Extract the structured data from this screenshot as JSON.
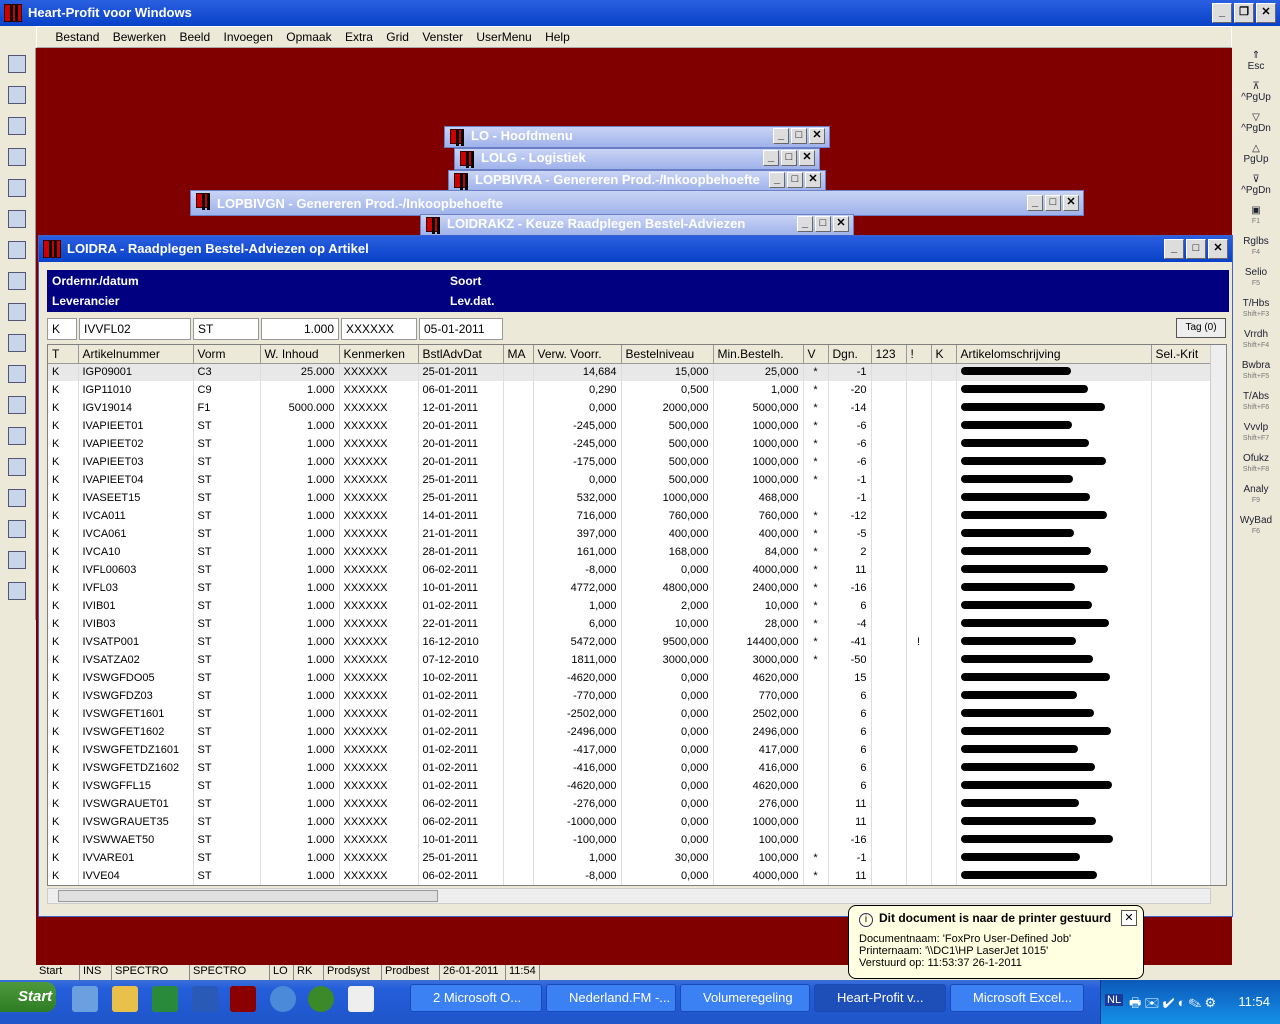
{
  "app": {
    "title": "Heart-Profit voor Windows"
  },
  "menu": [
    "Bestand",
    "Bewerken",
    "Beeld",
    "Invoegen",
    "Opmaak",
    "Extra",
    "Grid",
    "Venster",
    "UserMenu",
    "Help"
  ],
  "right_toolbar": [
    {
      "label": "Esc",
      "sub": ""
    },
    {
      "label": "^PgUp",
      "sub": ""
    },
    {
      "label": "^PgDn",
      "sub": ""
    },
    {
      "label": "PgUp",
      "sub": ""
    },
    {
      "label": "^PgDn",
      "sub": ""
    },
    {
      "label": "",
      "sub": "F1"
    },
    {
      "label": "Rglbs",
      "sub": "F4"
    },
    {
      "label": "Selio",
      "sub": "F5"
    },
    {
      "label": "T/Hbs",
      "sub": "Shift+F3"
    },
    {
      "label": "Vrrdh",
      "sub": "Shift+F4"
    },
    {
      "label": "Bwbra",
      "sub": "Shift+F5"
    },
    {
      "label": "T/Abs",
      "sub": "Shift+F6"
    },
    {
      "label": "Vvvlp",
      "sub": "Shift+F7"
    },
    {
      "label": "Ofukz",
      "sub": "Shift+F8"
    },
    {
      "label": "Analy",
      "sub": "F9"
    },
    {
      "label": "WyBad",
      "sub": "F6"
    }
  ],
  "subwindows": [
    "LO - Hoofdmenu",
    "LOLG - Logistiek",
    "LOPBIVRA - Genereren Prod.-/Inkoopbehoefte",
    "LOPBIVGN - Genereren Prod.-/Inkoopbehoefte",
    "LOIDRAKZ - Keuze Raadplegen Bestel-Adviezen"
  ],
  "main": {
    "title": "LOIDRA - Raadplegen Bestel-Adviezen op Artikel",
    "header": {
      "ordernr": "Ordernr./datum",
      "soort": "Soort",
      "leverancier": "Leverancier",
      "levdat": "Lev.dat."
    },
    "filter": {
      "t": "K",
      "artikel": "IVVFL02",
      "vorm": "ST",
      "inhoud": "1.000",
      "kenmerken": "XXXXXX",
      "datum": "05-01-2011"
    },
    "tag_button": "Tag (0)",
    "columns": [
      "T",
      "Artikelnummer",
      "Vorm",
      "W. Inhoud",
      "Kenmerken",
      "BstlAdvDat",
      "MA",
      "Verw. Voorr.",
      "Bestelniveau",
      "Min.Bestelh.",
      "V",
      "Dgn.",
      "123",
      "!",
      "K",
      "Artikelomschrijving",
      "Sel.-Krit"
    ],
    "rows": [
      [
        "K",
        "IGP09001",
        "C3",
        "25.000",
        "XXXXXX",
        "25-01-2011",
        "",
        "14,684",
        "15,000",
        "25,000",
        "*",
        "-1",
        "",
        "",
        "",
        "Igo... DP300",
        ""
      ],
      [
        "K",
        "IGP11010",
        "C9",
        "1.000",
        "XXXXXX",
        "06-01-2011",
        "",
        "0,290",
        "0,500",
        "1,000",
        "*",
        "-20",
        "",
        "",
        "",
        "Kla... / Fl... Nat...",
        ""
      ],
      [
        "K",
        "IGV19014",
        "F1",
        "5000.000",
        "XXXXXX",
        "12-01-2011",
        "",
        "0,000",
        "2000,000",
        "5000,000",
        "*",
        "-14",
        "",
        "",
        "",
        "Lab... LTGS (Sym... 15/3)",
        ""
      ],
      [
        "K",
        "IVAPIEET01",
        "ST",
        "1.000",
        "XXXXXX",
        "20-01-2011",
        "",
        "-245,000",
        "500,000",
        "1000,000",
        "*",
        "-6",
        "",
        "",
        "",
        "Etiket ...",
        ""
      ],
      [
        "K",
        "IVAPIEET02",
        "ST",
        "1.000",
        "XXXXXX",
        "20-01-2011",
        "",
        "-245,000",
        "500,000",
        "1000,000",
        "*",
        "-6",
        "",
        "",
        "",
        "Etiket ...",
        ""
      ],
      [
        "K",
        "IVAPIEET03",
        "ST",
        "1.000",
        "XXXXXX",
        "20-01-2011",
        "",
        "-175,000",
        "500,000",
        "1000,000",
        "*",
        "-6",
        "",
        "",
        "",
        "Etiket ...",
        ""
      ],
      [
        "K",
        "IVAPIEET04",
        "ST",
        "1.000",
        "XXXXXX",
        "25-01-2011",
        "",
        "0,000",
        "500,000",
        "1000,000",
        "*",
        "-1",
        "",
        "",
        "",
        "Etiket ...",
        ""
      ],
      [
        "K",
        "IVASEET15",
        "ST",
        "1.000",
        "XXXXXX",
        "25-01-2011",
        "",
        "532,000",
        "1000,000",
        "468,000",
        "",
        "-1",
        "",
        "",
        "",
        "Etiket ...",
        ""
      ],
      [
        "K",
        "IVCA011",
        "ST",
        "1.000",
        "XXXXXX",
        "14-01-2011",
        "",
        "716,000",
        "760,000",
        "760,000",
        "*",
        "-12",
        "",
        "",
        "",
        "Can ...",
        ""
      ],
      [
        "K",
        "IVCA061",
        "ST",
        "1.000",
        "XXXXXX",
        "21-01-2011",
        "",
        "397,000",
        "400,000",
        "400,000",
        "*",
        "-5",
        "",
        "",
        "",
        "Can ...",
        ""
      ],
      [
        "K",
        "IVCA10",
        "ST",
        "1.000",
        "XXXXXX",
        "28-01-2011",
        "",
        "161,000",
        "168,000",
        "84,000",
        "*",
        "2",
        "",
        "",
        "",
        "Can ...",
        ""
      ],
      [
        "K",
        "IVFL00603",
        "ST",
        "1.000",
        "XXXXXX",
        "06-02-2011",
        "",
        "-8,000",
        "0,000",
        "4000,000",
        "*",
        "11",
        "",
        "",
        "",
        "Fle ...",
        ""
      ],
      [
        "K",
        "IVFL03",
        "ST",
        "1.000",
        "XXXXXX",
        "10-01-2011",
        "",
        "4772,000",
        "4800,000",
        "2400,000",
        "*",
        "-16",
        "",
        "",
        "",
        "Fles ...",
        ""
      ],
      [
        "K",
        "IVIB01",
        "ST",
        "1.000",
        "XXXXXX",
        "01-02-2011",
        "",
        "1,000",
        "2,000",
        "10,000",
        "*",
        "6",
        "",
        "",
        "",
        "Schale ...",
        ""
      ],
      [
        "K",
        "IVIB03",
        "ST",
        "1.000",
        "XXXXXX",
        "22-01-2011",
        "",
        "6,000",
        "10,000",
        "28,000",
        "*",
        "-4",
        "",
        "",
        "",
        "M... UN",
        ""
      ],
      [
        "K",
        "IVSATP001",
        "ST",
        "1.000",
        "XXXXXX",
        "16-12-2010",
        "",
        "5472,000",
        "9500,000",
        "14400,000",
        "*",
        "-41",
        "",
        "!",
        "",
        "P...",
        ""
      ],
      [
        "K",
        "IVSATZA02",
        "ST",
        "1.000",
        "XXXXXX",
        "07-12-2010",
        "",
        "1811,000",
        "3000,000",
        "3000,000",
        "*",
        "-50",
        "",
        "",
        "",
        "C...",
        ""
      ],
      [
        "K",
        "IVSWGFDO05",
        "ST",
        "1.000",
        "XXXXXX",
        "10-02-2011",
        "",
        "-4620,000",
        "0,000",
        "4620,000",
        "",
        "15",
        "",
        "",
        "",
        "D...",
        ""
      ],
      [
        "K",
        "IVSWGFDZ03",
        "ST",
        "1.000",
        "XXXXXX",
        "01-02-2011",
        "",
        "-770,000",
        "0,000",
        "770,000",
        "",
        "6",
        "",
        "",
        "",
        "D...",
        ""
      ],
      [
        "K",
        "IVSWGFET1601",
        "ST",
        "1.000",
        "XXXXXX",
        "01-02-2011",
        "",
        "-2502,000",
        "0,000",
        "2502,000",
        "",
        "6",
        "",
        "",
        "",
        "E...",
        ""
      ],
      [
        "K",
        "IVSWGFET1602",
        "ST",
        "1.000",
        "XXXXXX",
        "01-02-2011",
        "",
        "-2496,000",
        "0,000",
        "2496,000",
        "",
        "6",
        "",
        "",
        "",
        "E...",
        ""
      ],
      [
        "K",
        "IVSWGFETDZ1601",
        "ST",
        "1.000",
        "XXXXXX",
        "01-02-2011",
        "",
        "-417,000",
        "0,000",
        "417,000",
        "",
        "6",
        "",
        "",
        "",
        "D...",
        ""
      ],
      [
        "K",
        "IVSWGFETDZ1602",
        "ST",
        "1.000",
        "XXXXXX",
        "01-02-2011",
        "",
        "-416,000",
        "0,000",
        "416,000",
        "",
        "6",
        "",
        "",
        "",
        "D...",
        ""
      ],
      [
        "K",
        "IVSWGFFL15",
        "ST",
        "1.000",
        "XXXXXX",
        "01-02-2011",
        "",
        "-4620,000",
        "0,000",
        "4620,000",
        "",
        "6",
        "",
        "",
        "",
        "F...",
        ""
      ],
      [
        "K",
        "IVSWGRAUET01",
        "ST",
        "1.000",
        "XXXXXX",
        "06-02-2011",
        "",
        "-276,000",
        "0,000",
        "276,000",
        "",
        "11",
        "",
        "",
        "",
        "E...",
        ""
      ],
      [
        "K",
        "IVSWGRAUET35",
        "ST",
        "1.000",
        "XXXXXX",
        "06-02-2011",
        "",
        "-1000,000",
        "0,000",
        "1000,000",
        "",
        "11",
        "",
        "",
        "",
        "E...",
        ""
      ],
      [
        "K",
        "IVSWWAET50",
        "ST",
        "1.000",
        "XXXXXX",
        "10-01-2011",
        "",
        "-100,000",
        "0,000",
        "100,000",
        "",
        "-16",
        "",
        "",
        "",
        "E...",
        ""
      ],
      [
        "K",
        "IVVARE01",
        "ST",
        "1.000",
        "XXXXXX",
        "25-01-2011",
        "",
        "1,000",
        "30,000",
        "100,000",
        "*",
        "-1",
        "",
        "",
        "",
        "P...",
        ""
      ],
      [
        "K",
        "IVVE04",
        "ST",
        "1.000",
        "XXXXXX",
        "06-02-2011",
        "",
        "-8,000",
        "0,000",
        "4000,000",
        "*",
        "11",
        "",
        "",
        "",
        "V...",
        ""
      ]
    ]
  },
  "statusbar": [
    "Start",
    "INS",
    "SPECTRO",
    "SPECTRO",
    "LO",
    "RK",
    "Prodsyst",
    "Prodbest",
    "26-01-2011",
    "11:54"
  ],
  "balloon": {
    "title": "Dit document is naar de printer gestuurd",
    "line1": "Documentnaam: 'FoxPro User-Defined Job'",
    "line2": "Printernaam: '\\\\DC1\\HP LaserJet 1015'",
    "line3": "Verstuurd op: 11:53:37  26-1-2011"
  },
  "taskbar": {
    "start": "Start",
    "items": [
      "2 Microsoft O...",
      "Nederland.FM -...",
      "Volumeregeling",
      "Heart-Profit v...",
      "Microsoft Excel..."
    ],
    "lang": "NL",
    "clock": "11:54"
  }
}
